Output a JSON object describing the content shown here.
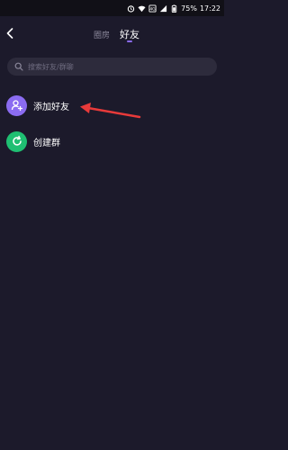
{
  "status_bar": {
    "battery_text": "75%",
    "time": "17:22",
    "icons": [
      "alarm-icon",
      "wifi-icon",
      "sim-icon",
      "signal-icon",
      "battery-icon"
    ]
  },
  "nav": {
    "back_icon": "chevron-left-icon",
    "tabs": [
      {
        "label": "圈房",
        "active": false
      },
      {
        "label": "好友",
        "active": true
      }
    ],
    "accent_color": "#8a6bf0"
  },
  "search": {
    "placeholder": "搜索好友/群聊",
    "icon": "search-icon"
  },
  "actions": [
    {
      "label": "添加好友",
      "icon": "add-user-icon",
      "color": "#8b6cf1"
    },
    {
      "label": "创建群",
      "icon": "refresh-icon",
      "color": "#1fbf72"
    }
  ],
  "annotation": {
    "color": "#e83a3a",
    "icon": "red-arrow"
  }
}
